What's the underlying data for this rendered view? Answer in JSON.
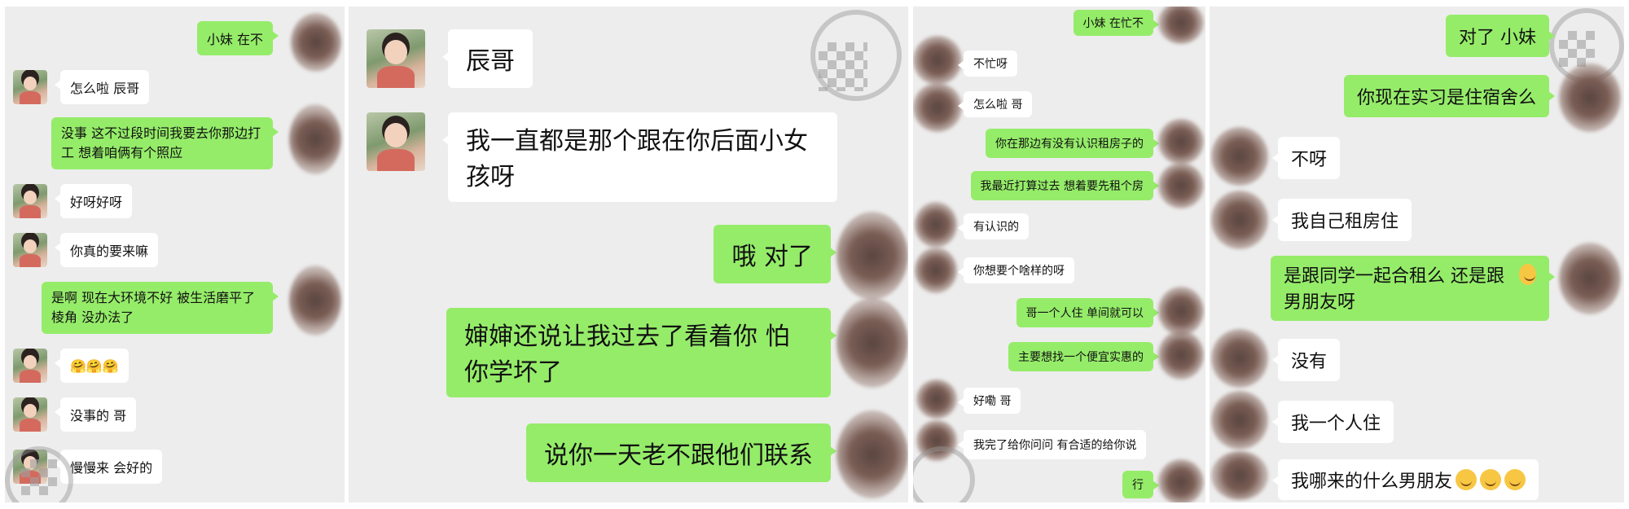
{
  "panel1": {
    "messages": [
      {
        "side": "me",
        "text": "小妹 在不"
      },
      {
        "side": "them",
        "text": "怎么啦  辰哥"
      },
      {
        "side": "me",
        "text": "没事 这不过段时间我要去你那边打工  想着咱俩有个照应"
      },
      {
        "side": "them",
        "text": "好呀好呀"
      },
      {
        "side": "them",
        "text": "你真的要来嘛"
      },
      {
        "side": "me",
        "text": "是啊  现在大环境不好 被生活磨平了棱角 没办法了"
      },
      {
        "side": "them",
        "text": "🤗🤗🤗"
      },
      {
        "side": "them",
        "text": "没事的 哥"
      },
      {
        "side": "them",
        "text": "慢慢来 会好的"
      }
    ]
  },
  "panel2": {
    "messages": [
      {
        "side": "them",
        "text": "辰哥"
      },
      {
        "side": "them",
        "text": "我一直都是那个跟在你后面小女孩呀"
      },
      {
        "side": "me",
        "text": "哦 对了"
      },
      {
        "side": "me",
        "text": "婶婶还说让我过去了看着你  怕你学坏了"
      },
      {
        "side": "me",
        "text": "说你一天老不跟他们联系"
      }
    ]
  },
  "panel3": {
    "messages": [
      {
        "side": "me",
        "text": "小妹 在忙不"
      },
      {
        "side": "them",
        "text": "不忙呀"
      },
      {
        "side": "them",
        "text": "怎么啦 哥"
      },
      {
        "side": "me",
        "text": "你在那边有没有认识租房子的"
      },
      {
        "side": "me",
        "text": "我最近打算过去 想着要先租个房"
      },
      {
        "side": "them",
        "text": "有认识的"
      },
      {
        "side": "them",
        "text": "你想要个啥样的呀"
      },
      {
        "side": "me",
        "text": "哥一个人住 单间就可以"
      },
      {
        "side": "me",
        "text": "主要想找一个便宜实惠的"
      },
      {
        "side": "them",
        "text": "好嘞 哥"
      },
      {
        "side": "them",
        "text": "我完了给你问问 有合适的给你说"
      },
      {
        "side": "me",
        "text": "行"
      }
    ]
  },
  "panel4": {
    "messages": [
      {
        "side": "me",
        "text": "对了 小妹"
      },
      {
        "side": "me",
        "text": "你现在实习是住宿舍么"
      },
      {
        "side": "them",
        "text": "不呀"
      },
      {
        "side": "them",
        "text": "我自己租房住"
      },
      {
        "side": "me",
        "text": "是跟同学一起合租么 还是跟男朋友呀"
      },
      {
        "side": "them",
        "text": "没有"
      },
      {
        "side": "them",
        "text": "我一个人住"
      },
      {
        "side": "them",
        "text": "我哪来的什么男朋友"
      }
    ]
  }
}
